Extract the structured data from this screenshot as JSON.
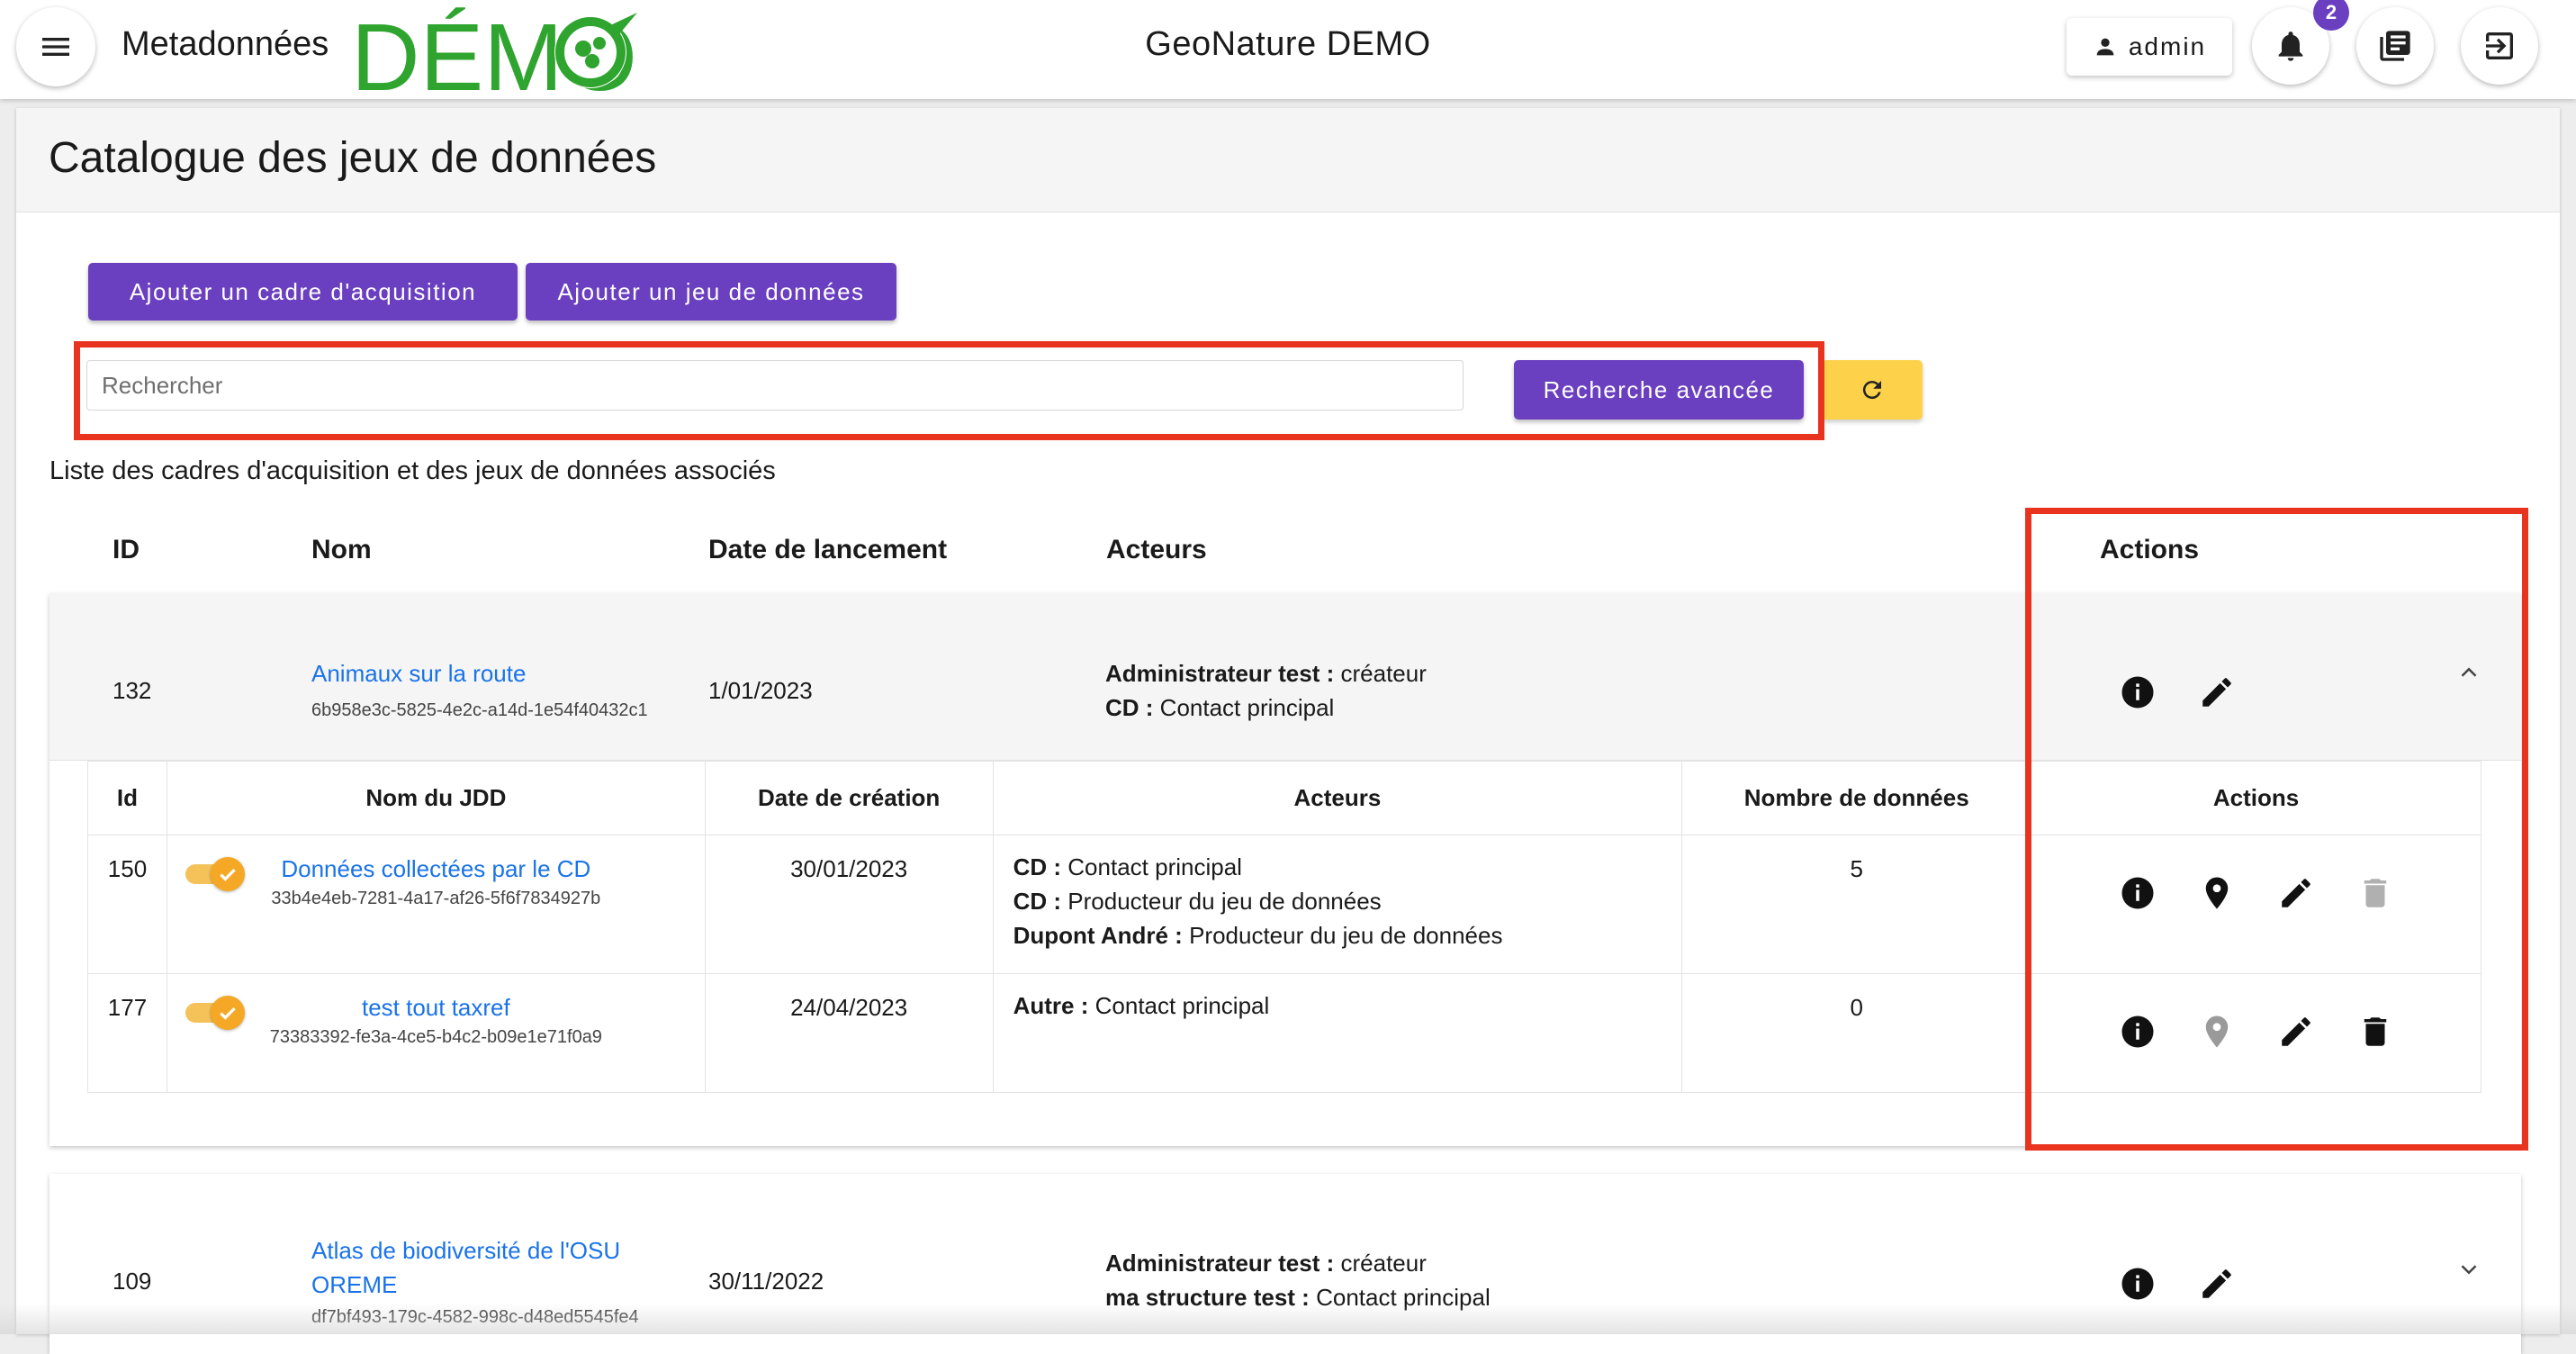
{
  "topbar": {
    "app_name": "Metadonnées",
    "logo_text": "DÉMO",
    "center_title": "GeoNature DEMO",
    "user": "admin",
    "notification_count": "2",
    "colors": {
      "logo_green": "#2fa52f",
      "accent_purple": "#6a3fc0"
    },
    "icons": [
      "menu-icon",
      "person-icon",
      "bell-icon",
      "library-books-icon",
      "logout-icon"
    ]
  },
  "page": {
    "title": "Catalogue des jeux de données",
    "btn_add_frame": "Ajouter un cadre d'acquisition",
    "btn_add_dataset": "Ajouter un jeu de données",
    "search_placeholder": "Rechercher",
    "btn_advanced_search": "Recherche avancée",
    "list_caption": "Liste des cadres d'acquisition et des jeux de données associés"
  },
  "table": {
    "headers": {
      "id": "ID",
      "name": "Nom",
      "date": "Date de lancement",
      "actors": "Acteurs",
      "actions": "Actions"
    },
    "sub_headers": {
      "id": "Id",
      "name": "Nom du JDD",
      "date": "Date de création",
      "actors": "Acteurs",
      "count": "Nombre de données",
      "actions": "Actions"
    },
    "frames": [
      {
        "id": "132",
        "name": "Animaux sur la route",
        "uuid": "6b958e3c-5825-4e2c-a14d-1e54f40432c1",
        "date": "1/01/2023",
        "actors": [
          {
            "role_holder": "Administrateur test :",
            "role": "créateur"
          },
          {
            "role_holder": "CD :",
            "role": "Contact principal"
          }
        ],
        "expanded": true,
        "datasets": [
          {
            "id": "150",
            "name": "Données collectées par le CD",
            "uuid": "33b4e4eb-7281-4a17-af26-5f6f7834927b",
            "date": "30/01/2023",
            "actors": [
              {
                "role_holder": "CD :",
                "role": "Contact principal"
              },
              {
                "role_holder": "CD :",
                "role": "Producteur du jeu de données"
              },
              {
                "role_holder": "Dupont André :",
                "role": "Producteur du jeu de données"
              }
            ],
            "count": "5",
            "map_enabled": true,
            "delete_enabled": false
          },
          {
            "id": "177",
            "name": "test tout taxref",
            "uuid": "73383392-fe3a-4ce5-b4c2-b09e1e71f0a9",
            "date": "24/04/2023",
            "actors": [
              {
                "role_holder": "Autre :",
                "role": "Contact principal"
              }
            ],
            "count": "0",
            "map_enabled": false,
            "delete_enabled": true
          }
        ]
      },
      {
        "id": "109",
        "name": "Atlas de biodiversité de l'OSU OREME",
        "uuid": "df7bf493-179c-4582-998c-d48ed5545fe4",
        "date": "30/11/2022",
        "actors": [
          {
            "role_holder": "Administrateur test :",
            "role": "créateur"
          },
          {
            "role_holder": "ma structure test :",
            "role": "Contact principal"
          }
        ],
        "expanded": false
      }
    ]
  }
}
